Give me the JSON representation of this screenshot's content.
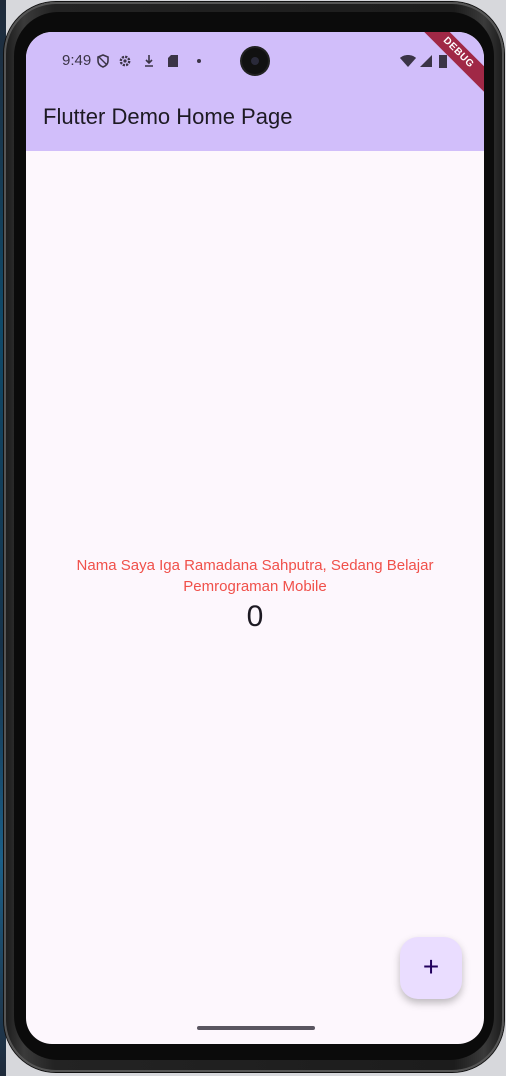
{
  "status_bar": {
    "time": "9:49",
    "left_icons": [
      "shield-icon",
      "settings-icon",
      "download-icon",
      "sd-card-icon",
      "dot-icon"
    ],
    "right_icons": [
      "wifi-icon",
      "signal-icon",
      "battery-icon"
    ]
  },
  "debug_banner": "DEBUG",
  "app_bar": {
    "title": "Flutter Demo Home Page",
    "color": "#d1befa"
  },
  "body": {
    "message": "Nama Saya Iga Ramadana Sahputra, Sedang Belajar Pemrograman Mobile",
    "message_color": "#f0504a",
    "counter": "0"
  },
  "fab": {
    "icon": "add-icon",
    "label": "+"
  }
}
